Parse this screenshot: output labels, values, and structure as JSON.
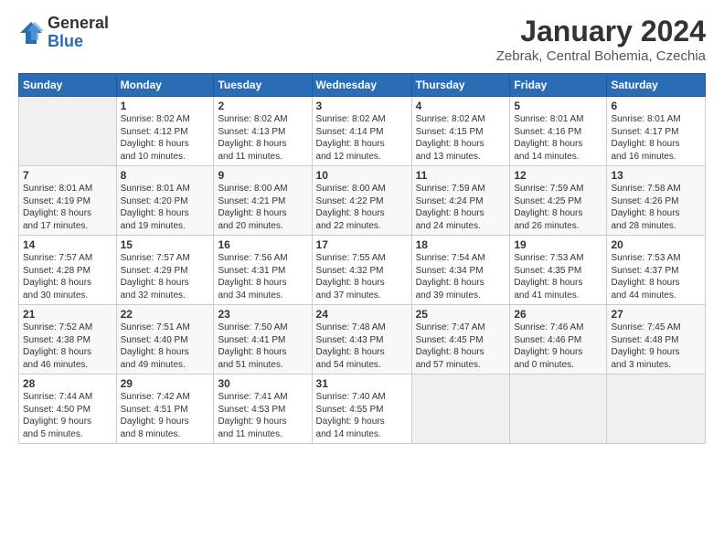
{
  "logo": {
    "general": "General",
    "blue": "Blue"
  },
  "title": "January 2024",
  "subtitle": "Zebrak, Central Bohemia, Czechia",
  "days_header": [
    "Sunday",
    "Monday",
    "Tuesday",
    "Wednesday",
    "Thursday",
    "Friday",
    "Saturday"
  ],
  "weeks": [
    [
      {
        "day": "",
        "info": ""
      },
      {
        "day": "1",
        "info": "Sunrise: 8:02 AM\nSunset: 4:12 PM\nDaylight: 8 hours\nand 10 minutes."
      },
      {
        "day": "2",
        "info": "Sunrise: 8:02 AM\nSunset: 4:13 PM\nDaylight: 8 hours\nand 11 minutes."
      },
      {
        "day": "3",
        "info": "Sunrise: 8:02 AM\nSunset: 4:14 PM\nDaylight: 8 hours\nand 12 minutes."
      },
      {
        "day": "4",
        "info": "Sunrise: 8:02 AM\nSunset: 4:15 PM\nDaylight: 8 hours\nand 13 minutes."
      },
      {
        "day": "5",
        "info": "Sunrise: 8:01 AM\nSunset: 4:16 PM\nDaylight: 8 hours\nand 14 minutes."
      },
      {
        "day": "6",
        "info": "Sunrise: 8:01 AM\nSunset: 4:17 PM\nDaylight: 8 hours\nand 16 minutes."
      }
    ],
    [
      {
        "day": "7",
        "info": "Sunrise: 8:01 AM\nSunset: 4:19 PM\nDaylight: 8 hours\nand 17 minutes."
      },
      {
        "day": "8",
        "info": "Sunrise: 8:01 AM\nSunset: 4:20 PM\nDaylight: 8 hours\nand 19 minutes."
      },
      {
        "day": "9",
        "info": "Sunrise: 8:00 AM\nSunset: 4:21 PM\nDaylight: 8 hours\nand 20 minutes."
      },
      {
        "day": "10",
        "info": "Sunrise: 8:00 AM\nSunset: 4:22 PM\nDaylight: 8 hours\nand 22 minutes."
      },
      {
        "day": "11",
        "info": "Sunrise: 7:59 AM\nSunset: 4:24 PM\nDaylight: 8 hours\nand 24 minutes."
      },
      {
        "day": "12",
        "info": "Sunrise: 7:59 AM\nSunset: 4:25 PM\nDaylight: 8 hours\nand 26 minutes."
      },
      {
        "day": "13",
        "info": "Sunrise: 7:58 AM\nSunset: 4:26 PM\nDaylight: 8 hours\nand 28 minutes."
      }
    ],
    [
      {
        "day": "14",
        "info": "Sunrise: 7:57 AM\nSunset: 4:28 PM\nDaylight: 8 hours\nand 30 minutes."
      },
      {
        "day": "15",
        "info": "Sunrise: 7:57 AM\nSunset: 4:29 PM\nDaylight: 8 hours\nand 32 minutes."
      },
      {
        "day": "16",
        "info": "Sunrise: 7:56 AM\nSunset: 4:31 PM\nDaylight: 8 hours\nand 34 minutes."
      },
      {
        "day": "17",
        "info": "Sunrise: 7:55 AM\nSunset: 4:32 PM\nDaylight: 8 hours\nand 37 minutes."
      },
      {
        "day": "18",
        "info": "Sunrise: 7:54 AM\nSunset: 4:34 PM\nDaylight: 8 hours\nand 39 minutes."
      },
      {
        "day": "19",
        "info": "Sunrise: 7:53 AM\nSunset: 4:35 PM\nDaylight: 8 hours\nand 41 minutes."
      },
      {
        "day": "20",
        "info": "Sunrise: 7:53 AM\nSunset: 4:37 PM\nDaylight: 8 hours\nand 44 minutes."
      }
    ],
    [
      {
        "day": "21",
        "info": "Sunrise: 7:52 AM\nSunset: 4:38 PM\nDaylight: 8 hours\nand 46 minutes."
      },
      {
        "day": "22",
        "info": "Sunrise: 7:51 AM\nSunset: 4:40 PM\nDaylight: 8 hours\nand 49 minutes."
      },
      {
        "day": "23",
        "info": "Sunrise: 7:50 AM\nSunset: 4:41 PM\nDaylight: 8 hours\nand 51 minutes."
      },
      {
        "day": "24",
        "info": "Sunrise: 7:48 AM\nSunset: 4:43 PM\nDaylight: 8 hours\nand 54 minutes."
      },
      {
        "day": "25",
        "info": "Sunrise: 7:47 AM\nSunset: 4:45 PM\nDaylight: 8 hours\nand 57 minutes."
      },
      {
        "day": "26",
        "info": "Sunrise: 7:46 AM\nSunset: 4:46 PM\nDaylight: 9 hours\nand 0 minutes."
      },
      {
        "day": "27",
        "info": "Sunrise: 7:45 AM\nSunset: 4:48 PM\nDaylight: 9 hours\nand 3 minutes."
      }
    ],
    [
      {
        "day": "28",
        "info": "Sunrise: 7:44 AM\nSunset: 4:50 PM\nDaylight: 9 hours\nand 5 minutes."
      },
      {
        "day": "29",
        "info": "Sunrise: 7:42 AM\nSunset: 4:51 PM\nDaylight: 9 hours\nand 8 minutes."
      },
      {
        "day": "30",
        "info": "Sunrise: 7:41 AM\nSunset: 4:53 PM\nDaylight: 9 hours\nand 11 minutes."
      },
      {
        "day": "31",
        "info": "Sunrise: 7:40 AM\nSunset: 4:55 PM\nDaylight: 9 hours\nand 14 minutes."
      },
      {
        "day": "",
        "info": ""
      },
      {
        "day": "",
        "info": ""
      },
      {
        "day": "",
        "info": ""
      }
    ]
  ]
}
